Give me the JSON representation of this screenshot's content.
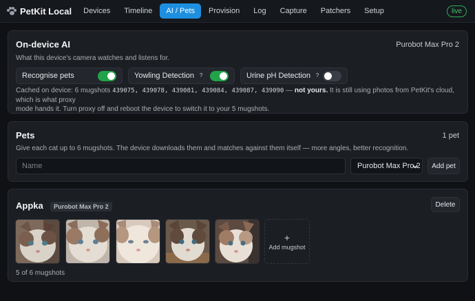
{
  "app": {
    "title": "PetKit Local",
    "status": "live"
  },
  "nav": {
    "tabs": [
      {
        "label": "Devices"
      },
      {
        "label": "Timeline"
      },
      {
        "label": "AI / Pets"
      },
      {
        "label": "Provision"
      },
      {
        "label": "Log"
      },
      {
        "label": "Capture"
      },
      {
        "label": "Patchers"
      },
      {
        "label": "Setup"
      }
    ],
    "active": "AI / Pets"
  },
  "ai": {
    "title": "On-device AI",
    "device": "Purobot Max Pro 2",
    "subtitle": "What this device's camera watches and listens for.",
    "toggles": [
      {
        "label": "Recognise pets",
        "on": true,
        "help": ""
      },
      {
        "label": "Yowling Detection",
        "on": true,
        "help": "?"
      },
      {
        "label": "Urine pH Detection",
        "on": false,
        "help": "?"
      }
    ],
    "cached_prefix": "Cached on device: 6 mugshots",
    "cached_ids": "439075, 439078, 439081, 439084, 439087, 439090",
    "cached_dash": "—",
    "cached_not_yours": "not yours.",
    "cached_rest_1": "It is still using photos from PetKit's cloud, which is what proxy",
    "cached_rest_2": "mode hands it. Turn proxy off and reboot the device to switch it to your 5 mugshots."
  },
  "pets": {
    "title": "Pets",
    "count": "1 pet",
    "subtitle": "Give each cat up to 6 mugshots. The device downloads them and matches against them itself — more angles, better recognition.",
    "name_placeholder": "Name",
    "device_select": "Purobot Max Pro 2",
    "add_label": "Add pet"
  },
  "pet": {
    "name": "Appka",
    "device_badge": "Purobot Max Pro 2",
    "delete_label": "Delete",
    "add_mugshot_plus": "+",
    "add_mugshot_label": "Add mugshot",
    "mugshot_count": "5 of 6 mugshots"
  },
  "colors": {
    "accent": "#1d8fe0",
    "toggle_on": "#22a34a",
    "live": "#47c774"
  }
}
